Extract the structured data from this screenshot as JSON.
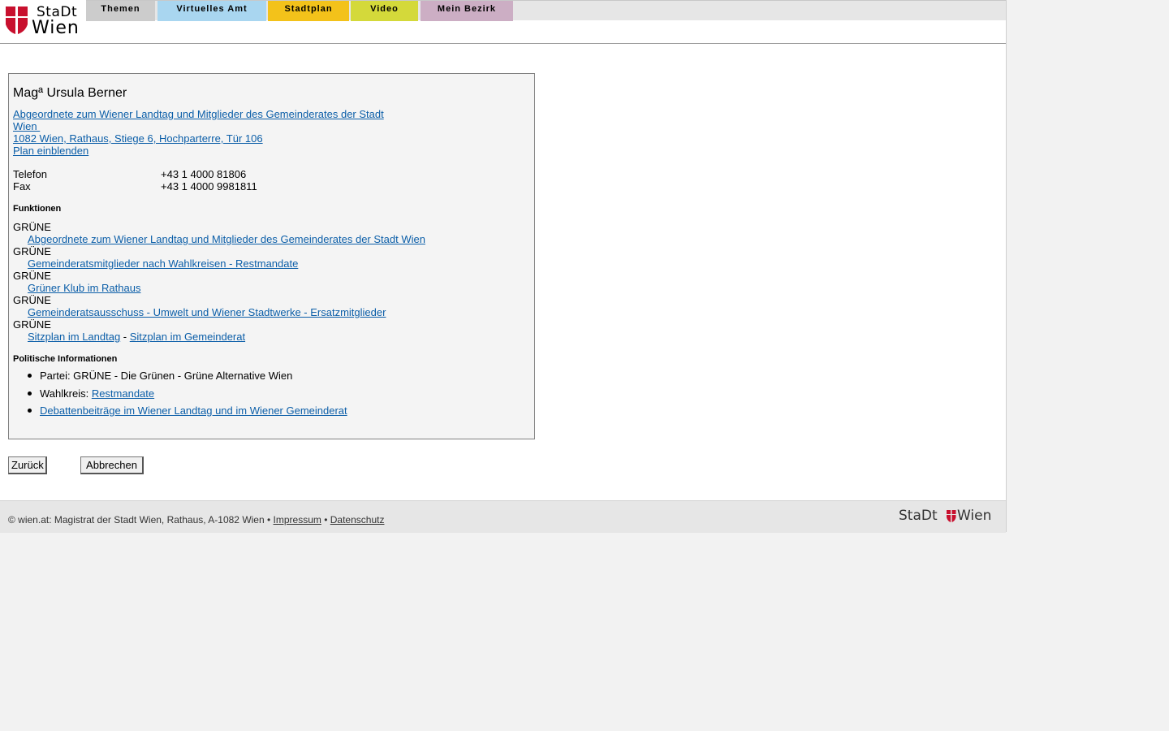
{
  "header": {
    "logo": {
      "line1": "StaDt",
      "line2": "Wien",
      "icon": "vienna-shield-icon"
    },
    "nav": [
      {
        "label": "Themen",
        "color": "#cccccc"
      },
      {
        "label": "Virtuelles Amt",
        "color": "#a9d6f0"
      },
      {
        "label": "Stadtplan",
        "color": "#f3c21a"
      },
      {
        "label": "Video",
        "color": "#d4d93a"
      },
      {
        "label": "Mein Bezirk",
        "color": "#ccaec4"
      }
    ]
  },
  "person": {
    "name": "Magª Ursula Berner",
    "role_line1": "Abgeordnete zum Wiener Landtag und Mitglieder des Gemeinderates der Stadt",
    "role_line2": "Wien ",
    "address": "1082 Wien, Rathaus, Stiege 6, Hochparterre, Tür 106",
    "map_link": "Plan einblenden",
    "contact": [
      {
        "label": "Telefon",
        "value": "+43 1 4000 81806"
      },
      {
        "label": "Fax",
        "value": "+43 1 4000 9981811"
      }
    ]
  },
  "functions": {
    "title": "Funktionen",
    "items": [
      {
        "party": "GRÜNE",
        "link": "Abgeordnete zum Wiener Landtag und Mitglieder des Gemeinderates der Stadt Wien"
      },
      {
        "party": "GRÜNE",
        "link": "Gemeinderatsmitglieder nach Wahlkreisen - Restmandate"
      },
      {
        "party": "GRÜNE",
        "link": "Grüner Klub im Rathaus"
      },
      {
        "party": "GRÜNE",
        "link": "Gemeinderatsausschuss - Umwelt und Wiener Stadtwerke - Ersatzmitglieder"
      }
    ],
    "last_party": "GRÜNE",
    "seat_link_1": "Sitzplan im Landtag",
    "seat_separator": " - ",
    "seat_link_2": "Sitzplan im Gemeinderat"
  },
  "political": {
    "title": "Politische Informationen",
    "party_label": "Partei: GRÜNE - Die Grünen - Grüne Alternative Wien",
    "district_label": "Wahlkreis: ",
    "district_link": "Restmandate",
    "debates_link": "Debattenbeiträge im Wiener Landtag und im Wiener Gemeinderat"
  },
  "buttons": {
    "back": "Zurück",
    "cancel": "Abbrechen"
  },
  "footer": {
    "text": "© wien.at: Magistrat der Stadt Wien, Rathaus, A-1082 Wien • ",
    "impressum": "Impressum",
    "sep": " • ",
    "datenschutz": "Datenschutz",
    "logo_left": "StaDt",
    "logo_right": "Wien"
  }
}
